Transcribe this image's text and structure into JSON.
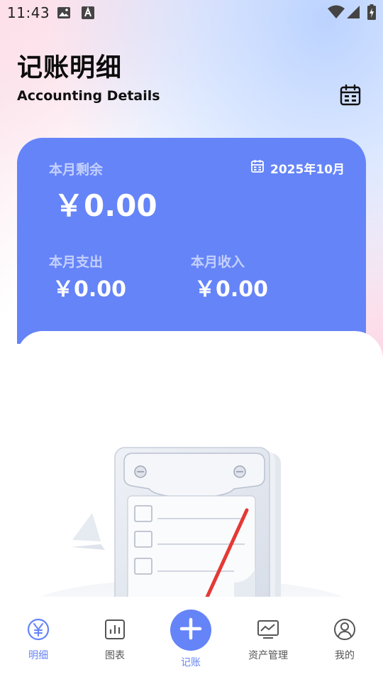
{
  "status_bar": {
    "time": "11:43",
    "icons": [
      "image-icon",
      "font-download-icon",
      "wifi-icon",
      "signal-icon",
      "battery-charging-icon"
    ]
  },
  "header": {
    "title": "记账明细",
    "subtitle": "Accounting Details",
    "calendar_icon": "calendar-icon"
  },
  "summary": {
    "balance_label": "本月剩余",
    "balance_value": "￥0.00",
    "date": "2025年10月",
    "expense_label": "本月支出",
    "expense_value": "￥0.00",
    "income_label": "本月收入",
    "income_value": "￥0.00"
  },
  "colors": {
    "accent": "#6584f8",
    "arrow": "#e53935"
  },
  "nav": {
    "items": [
      {
        "label": "明细",
        "icon": "yuan-circle-icon",
        "active": true
      },
      {
        "label": "图表",
        "icon": "bar-chart-icon",
        "active": false
      },
      {
        "label": "记账",
        "icon": "plus-icon",
        "active": false
      },
      {
        "label": "资产管理",
        "icon": "monitor-chart-icon",
        "active": false
      },
      {
        "label": "我的",
        "icon": "user-icon",
        "active": false
      }
    ]
  }
}
